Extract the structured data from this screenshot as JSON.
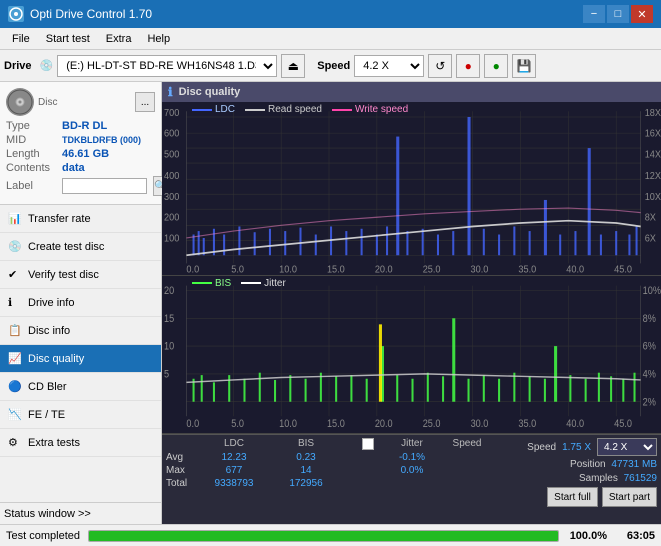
{
  "titlebar": {
    "title": "Opti Drive Control 1.70",
    "minimize_label": "−",
    "maximize_label": "□",
    "close_label": "✕"
  },
  "menubar": {
    "items": [
      "File",
      "Start test",
      "Extra",
      "Help"
    ]
  },
  "toolbar": {
    "drive_label": "Drive",
    "drive_value": "(E:)  HL-DT-ST BD-RE  WH16NS48 1.D3",
    "speed_label": "Speed",
    "speed_value": "4.2 X"
  },
  "disc": {
    "type_label": "Type",
    "type_value": "BD-R DL",
    "mid_label": "MID",
    "mid_value": "TDKBLDRFB (000)",
    "length_label": "Length",
    "length_value": "46.61 GB",
    "contents_label": "Contents",
    "contents_value": "data",
    "label_label": "Label",
    "label_value": ""
  },
  "sidebar_nav": [
    {
      "id": "transfer-rate",
      "label": "Transfer rate",
      "active": false
    },
    {
      "id": "create-test-disc",
      "label": "Create test disc",
      "active": false
    },
    {
      "id": "verify-test-disc",
      "label": "Verify test disc",
      "active": false
    },
    {
      "id": "drive-info",
      "label": "Drive info",
      "active": false
    },
    {
      "id": "disc-info",
      "label": "Disc info",
      "active": false
    },
    {
      "id": "disc-quality",
      "label": "Disc quality",
      "active": true
    },
    {
      "id": "cd-bler",
      "label": "CD Bler",
      "active": false
    },
    {
      "id": "fe-te",
      "label": "FE / TE",
      "active": false
    },
    {
      "id": "extra-tests",
      "label": "Extra tests",
      "active": false
    }
  ],
  "disc_quality": {
    "title": "Disc quality",
    "legend": [
      {
        "label": "LDC",
        "color": "#4466ff"
      },
      {
        "label": "Read speed",
        "color": "#cccccc"
      },
      {
        "label": "Write speed",
        "color": "#ff44aa"
      }
    ],
    "legend2": [
      {
        "label": "BIS",
        "color": "#44ff44"
      },
      {
        "label": "Jitter",
        "color": "#ffffff"
      }
    ],
    "chart1_y_max": 700,
    "chart1_y_right_max": 18,
    "chart2_y_max": 20,
    "chart2_y_right_max": 10,
    "x_max": 50
  },
  "stats": {
    "headers": [
      "",
      "LDC",
      "BIS",
      "",
      "Jitter",
      "Speed",
      "",
      ""
    ],
    "avg_label": "Avg",
    "avg_ldc": "12.23",
    "avg_bis": "0.23",
    "avg_jitter": "-0.1%",
    "max_label": "Max",
    "max_ldc": "677",
    "max_bis": "14",
    "max_jitter": "0.0%",
    "total_label": "Total",
    "total_ldc": "9338793",
    "total_bis": "172956",
    "speed_label": "Speed",
    "speed_value": "1.75 X",
    "speed_select": "4.2 X",
    "position_label": "Position",
    "position_value": "47731 MB",
    "samples_label": "Samples",
    "samples_value": "761529",
    "start_full_label": "Start full",
    "start_part_label": "Start part"
  },
  "status": {
    "text": "Test completed",
    "progress": 100,
    "percent_label": "100.0%",
    "value_label": "63:05"
  }
}
